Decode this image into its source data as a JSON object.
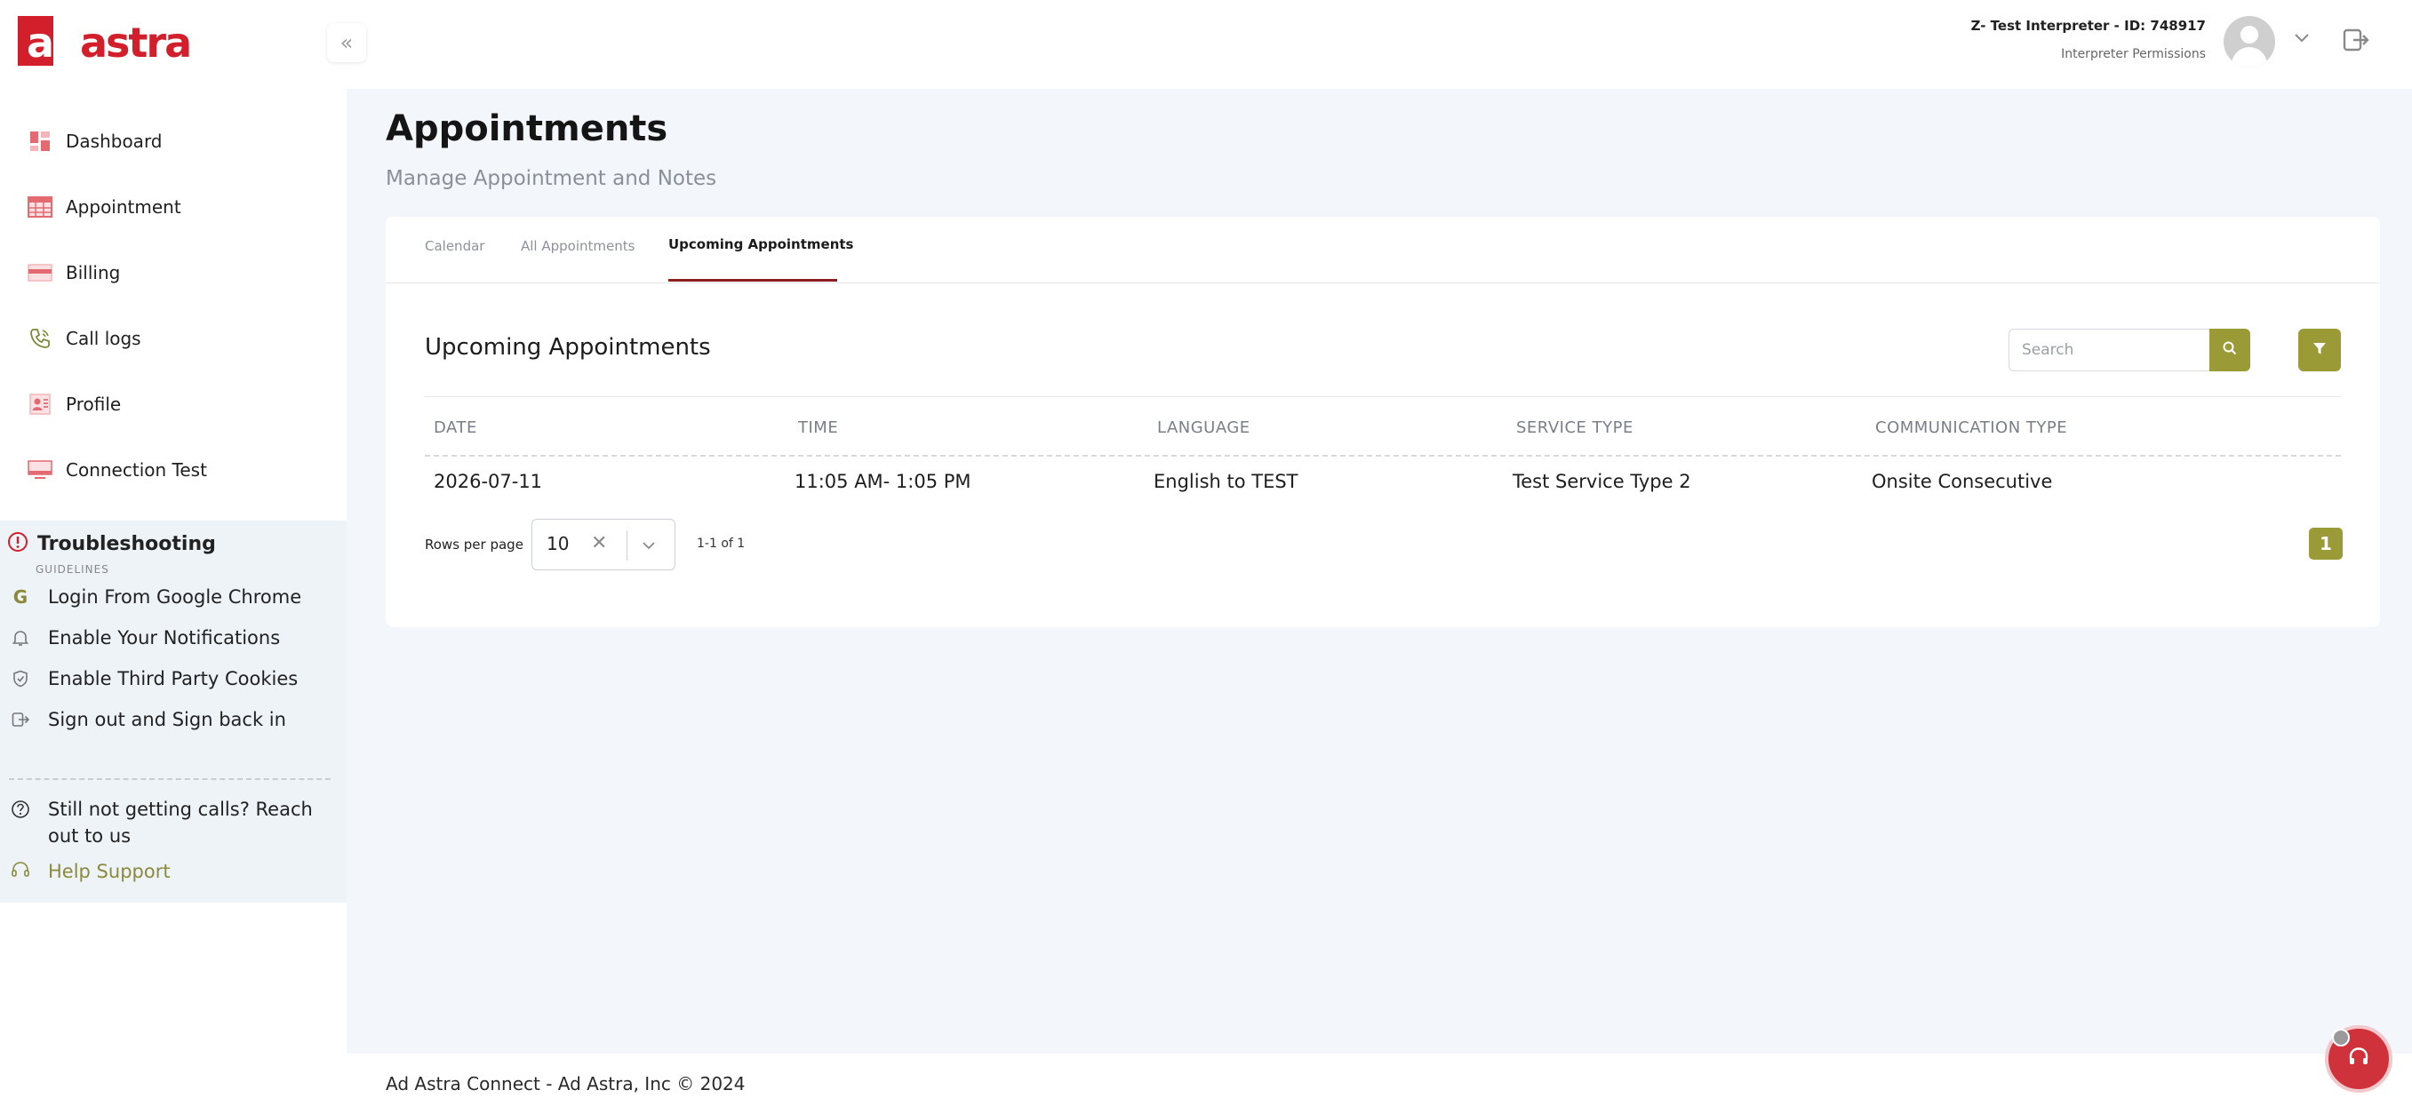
{
  "brand": {
    "logo_text": "adastra",
    "accent": "#d21f2b",
    "olive": "#9a9a36"
  },
  "header": {
    "user_name": "Z- Test Interpreter - ID: 748917",
    "user_role": "Interpreter Permissions"
  },
  "sidebar": {
    "items": [
      {
        "label": "Dashboard",
        "icon": "dashboard-icon"
      },
      {
        "label": "Appointment",
        "icon": "calendar-icon"
      },
      {
        "label": "Billing",
        "icon": "billing-icon"
      },
      {
        "label": "Call logs",
        "icon": "phone-icon"
      },
      {
        "label": "Profile",
        "icon": "profile-icon"
      },
      {
        "label": "Connection Test",
        "icon": "monitor-icon"
      }
    ],
    "troubleshooting": {
      "title": "Troubleshooting",
      "subtitle": "GUIDELINES",
      "guides": [
        {
          "label": "Login From Google Chrome",
          "icon": "google-icon"
        },
        {
          "label": "Enable Your Notifications",
          "icon": "bell-icon"
        },
        {
          "label": "Enable Third Party Cookies",
          "icon": "shield-icon"
        },
        {
          "label": "Sign out and Sign back in",
          "icon": "signout-icon"
        }
      ],
      "still_text": "Still not getting calls? Reach out to us",
      "help_label": "Help Support"
    }
  },
  "main": {
    "title": "Appointments",
    "subtitle": "Manage Appointment and Notes",
    "tabs": [
      {
        "label": "Calendar",
        "active": false
      },
      {
        "label": "All Appointments",
        "active": false
      },
      {
        "label": "Upcoming Appointments",
        "active": true
      }
    ],
    "section_title": "Upcoming Appointments",
    "search_placeholder": "Search",
    "table": {
      "columns": [
        "DATE",
        "TIME",
        "LANGUAGE",
        "SERVICE TYPE",
        "COMMUNICATION TYPE"
      ],
      "rows": [
        [
          "2026-07-11",
          "11:05 AM- 1:05 PM",
          "English to TEST",
          "Test Service Type 2",
          "Onsite Consecutive"
        ]
      ]
    },
    "pager": {
      "rows_per_page_label": "Rows per page",
      "rows_per_page_value": "10",
      "range": "1-1 of 1",
      "current_page": "1"
    }
  },
  "footer": {
    "text": "Ad Astra Connect - Ad Astra, Inc © 2024"
  }
}
